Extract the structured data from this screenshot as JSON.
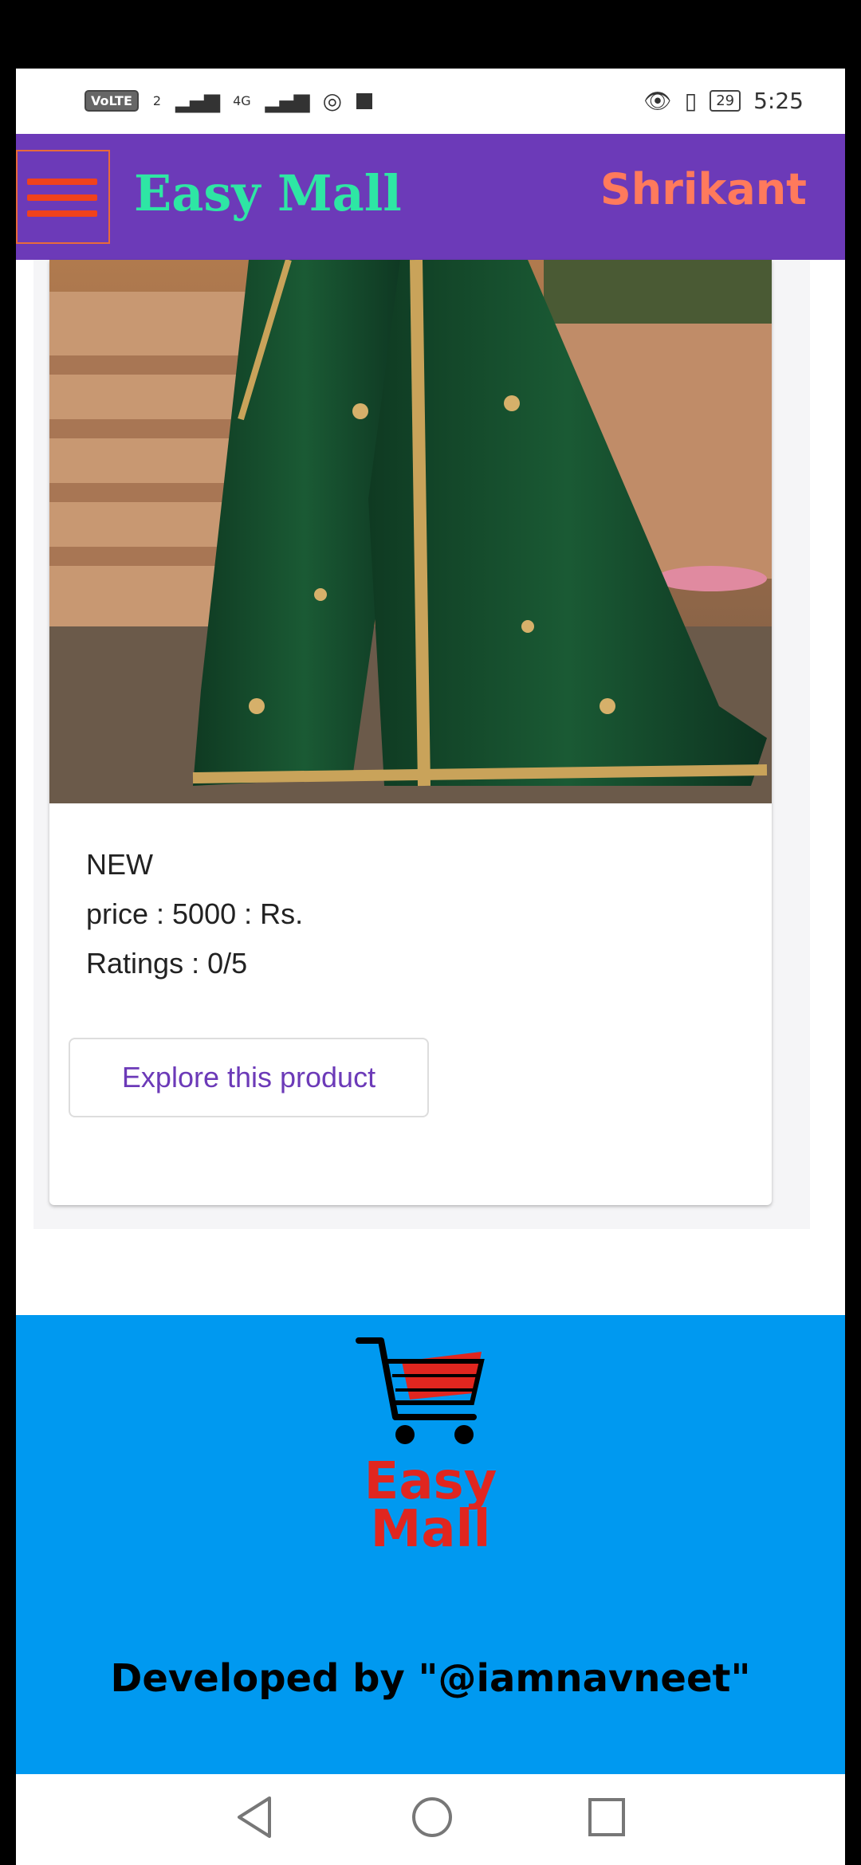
{
  "status_bar": {
    "volte": "VoLTE",
    "sim_slot": "2",
    "network": "4G",
    "battery": "29",
    "time": "5:25"
  },
  "header": {
    "app_title": "Easy Mall",
    "user_name": "Shrikant",
    "menu_icon": "hamburger-menu-icon"
  },
  "product": {
    "image": "green embroidered saree",
    "badge": "NEW",
    "price_text": "price : 5000 : Rs.",
    "ratings_text": "Ratings : 0/5",
    "explore_label": "Explore this product"
  },
  "footer": {
    "logo_icon": "shopping-cart-icon",
    "logo_line1": "Easy",
    "logo_line2": "Mall",
    "developer_text": "Developed by \"@iamnavneet\""
  },
  "nav_bar": {
    "back_icon": "back-triangle-icon",
    "home_icon": "home-circle-icon",
    "recents_icon": "recents-square-icon"
  },
  "colors": {
    "appbar": "#6c3ab8",
    "title": "#2ee6a4",
    "user": "#ff7a5c",
    "menu_lines": "#f0421c",
    "footer_bg": "#0099f0",
    "footer_logo": "#e0261f"
  }
}
